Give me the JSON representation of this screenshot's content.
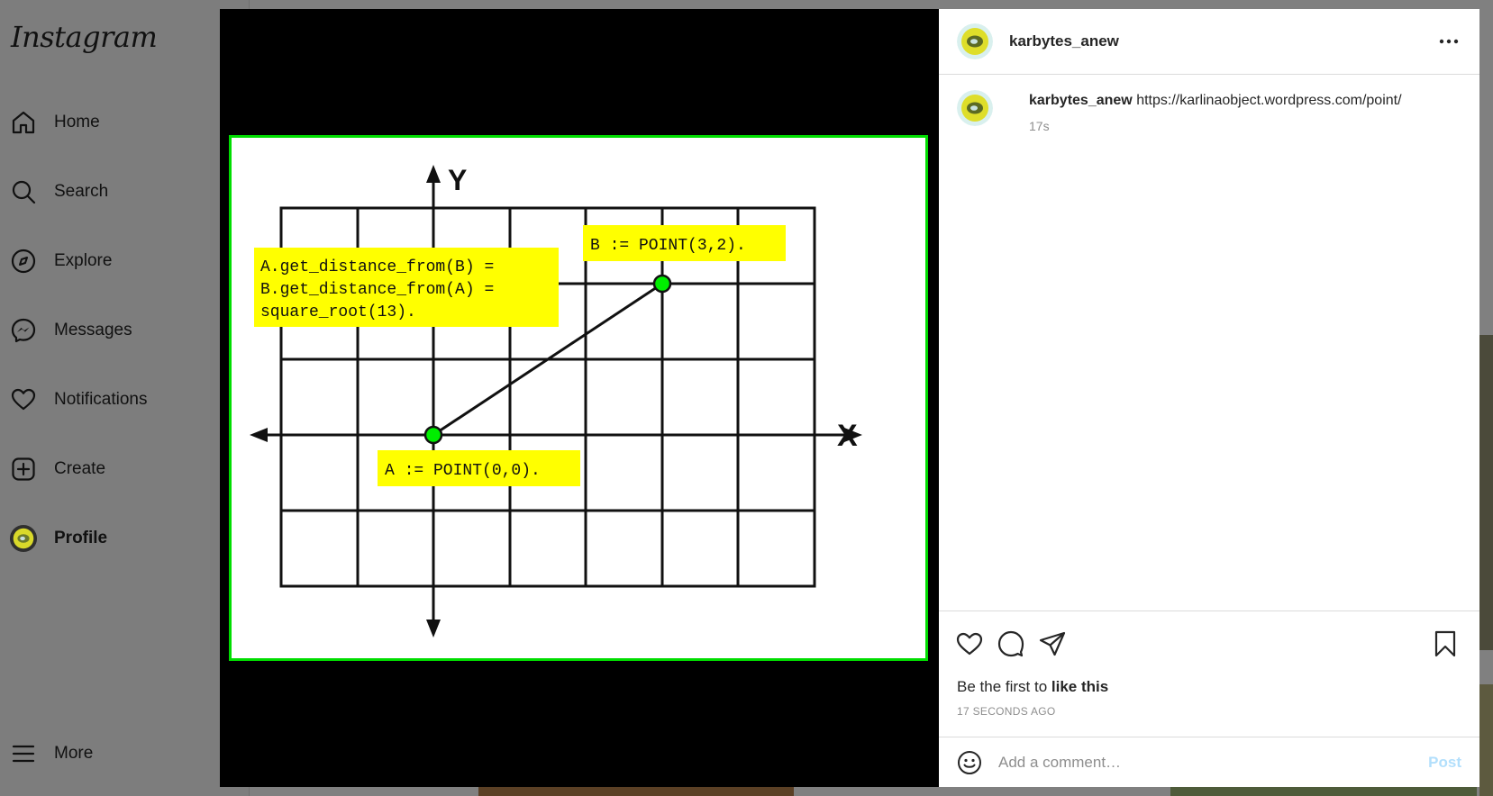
{
  "app": {
    "logo": "Instagram"
  },
  "sidebar": {
    "items": [
      {
        "label": "Home",
        "icon": "home-icon"
      },
      {
        "label": "Search",
        "icon": "search-icon"
      },
      {
        "label": "Explore",
        "icon": "compass-icon"
      },
      {
        "label": "Messages",
        "icon": "messenger-icon"
      },
      {
        "label": "Notifications",
        "icon": "heart-icon"
      },
      {
        "label": "Create",
        "icon": "plus-square-icon"
      },
      {
        "label": "Profile",
        "icon": "avatar"
      }
    ],
    "more_label": "More"
  },
  "post": {
    "username": "karbytes_anew",
    "caption_link": "https://karlinaobject.wordpress.com/point/",
    "caption_time": "17s",
    "likes_prefix": "Be the first to ",
    "likes_action": "like this",
    "time_ago": "17 SECONDS AGO",
    "comment_placeholder": "Add a comment…",
    "post_button": "Post",
    "image": {
      "axis_y": "Y",
      "axis_x": "X",
      "label_b": "B := POINT(3,2).",
      "label_a": "A := POINT(0,0).",
      "distance_line1": "A.get_distance_from(B) =",
      "distance_line2": "B.get_distance_from(A) =",
      "distance_line3": "square_root(13).",
      "frame_color": "#00dd00",
      "point_color": "#00ee00",
      "label_bg": "#ffff00"
    }
  }
}
